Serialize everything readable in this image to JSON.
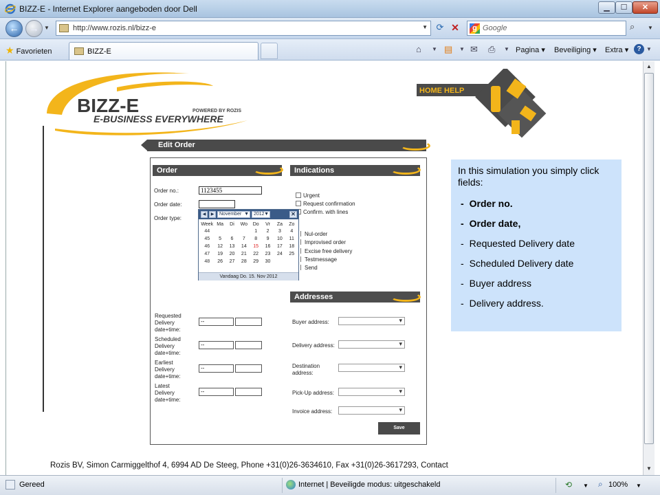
{
  "browser": {
    "window_title": "BIZZ-E - Internet Explorer aangeboden door Dell",
    "url": "http://www.rozis.nl/bizz-e",
    "search_placeholder": "Google",
    "favorites_label": "Favorieten",
    "tab_label": "BIZZ-E",
    "commands": {
      "page": "Pagina",
      "security": "Beveiliging",
      "extra": "Extra"
    },
    "status": {
      "ready": "Gereed",
      "zone": "Internet | Beveiligde modus: uitgeschakeld",
      "zoom": "100%"
    }
  },
  "logo": {
    "name": "BIZZ-E",
    "powered_by": "POWERED BY ROZIS",
    "tagline": "E-BUSINESS EVERYWHERE"
  },
  "home_help": "HOME HELP",
  "edit_order": {
    "title": "Edit Order"
  },
  "order": {
    "heading": "Order",
    "order_no_label": "Order no.:",
    "order_no_value": "1123455",
    "order_date_label": "Order date:",
    "order_type_label": "Order type:"
  },
  "calendar": {
    "month": "November",
    "year": "2012",
    "close": "✕",
    "headers": [
      "Week",
      "Ma",
      "Di",
      "Wo",
      "Do",
      "Vr",
      "Za",
      "Zo"
    ],
    "rows": [
      [
        "44",
        "",
        "",
        "",
        "1",
        "2",
        "3",
        "4"
      ],
      [
        "45",
        "5",
        "6",
        "7",
        "8",
        "9",
        "10",
        "11"
      ],
      [
        "46",
        "12",
        "13",
        "14",
        "15",
        "16",
        "17",
        "18"
      ],
      [
        "47",
        "19",
        "20",
        "21",
        "22",
        "23",
        "24",
        "25"
      ],
      [
        "48",
        "26",
        "27",
        "28",
        "29",
        "30",
        "",
        ""
      ]
    ],
    "today_value": "15",
    "footer": "Vandaag Do. 15. Nov 2012"
  },
  "indications": {
    "heading": "Indications",
    "checkboxes": [
      "Urgent",
      "Request confirmation",
      "Confirm. with lines"
    ],
    "options": [
      "Nul-order",
      "Improvised order",
      "Excise free delivery",
      "Testmessage",
      "Send"
    ]
  },
  "dates": [
    {
      "label": "Requested Delivery date+time:",
      "date": "--"
    },
    {
      "label": "Scheduled Delivery date+time:",
      "date": "--"
    },
    {
      "label": "Earliest Delivery date+time:",
      "date": "--"
    },
    {
      "label": "Latest Delivery date+time:",
      "date": "--"
    }
  ],
  "addresses": {
    "heading": "Addresses",
    "fields": [
      "Buyer address:",
      "Delivery address:",
      "Destination address:",
      "Pick-Up address:",
      "Invoice address:"
    ]
  },
  "save_label": "Save",
  "info": {
    "intro": "In this simulation you simply click fields:",
    "items": [
      {
        "text": "Order no.",
        "bold": true
      },
      {
        "text": "Order date,",
        "bold": true
      },
      {
        "text": "Requested Delivery date",
        "bold": false
      },
      {
        "text": "Scheduled Delivery date",
        "bold": false
      },
      {
        "text": "Buyer address",
        "bold": false
      },
      {
        "text": "Delivery address.",
        "bold": false
      }
    ]
  },
  "footer": "Rozis BV, Simon Carmiggelthof 4, 6994 AD De Steeg, Phone +31(0)26-3634610, Fax +31(0)26-3617293, Contact",
  "colors": {
    "accent_yellow": "#f3b51b",
    "dark_bar": "#4a4a4a",
    "info_bg": "#cde3fb",
    "ie_blue": "#2a63a8"
  }
}
